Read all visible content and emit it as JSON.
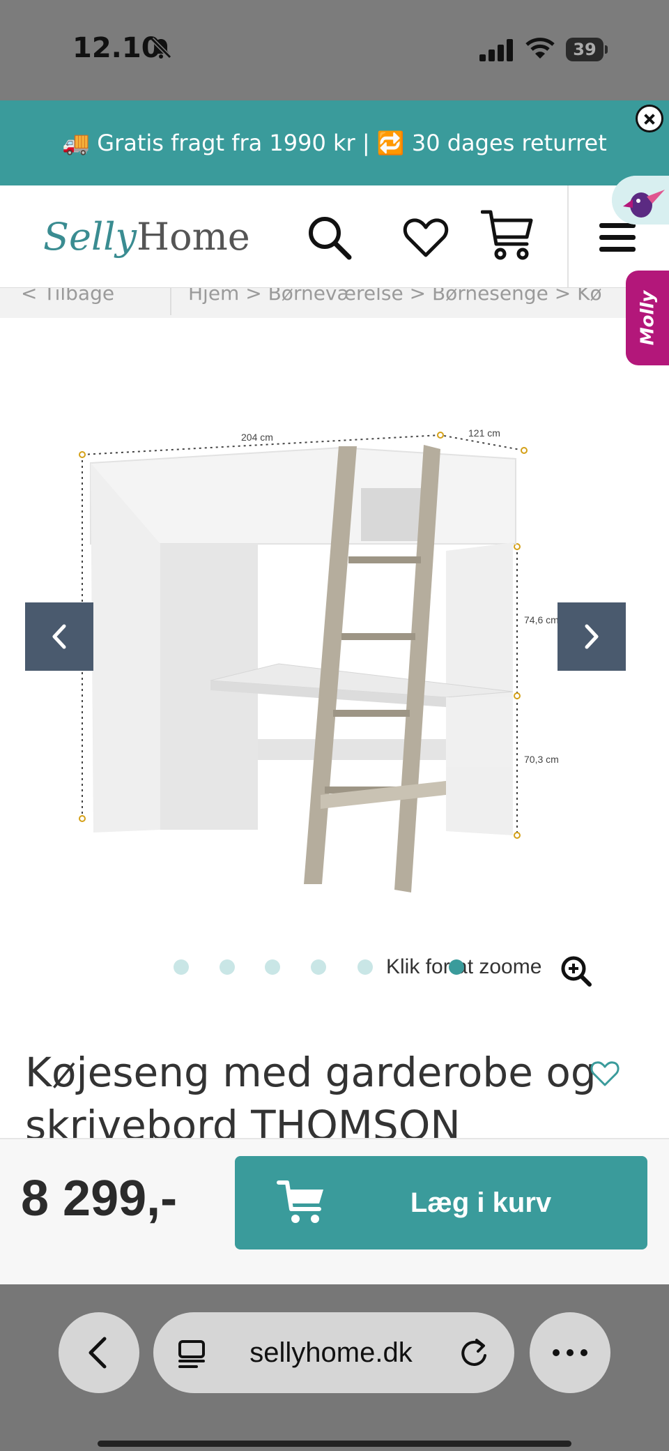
{
  "status_bar": {
    "time": "12.10",
    "battery": "39"
  },
  "promo": {
    "text": "🚚 Gratis fragt fra 1990 kr | 🔁 30 dages returret"
  },
  "header": {
    "logo_script": "Selly",
    "logo_word": "Home"
  },
  "breadcrumb": {
    "back": "< Tilbage",
    "trail": "Hjem > Børneværelse > Børnesenge > Kø"
  },
  "chat": {
    "label": "Molly"
  },
  "product": {
    "image_labels": {
      "width": "204 cm",
      "depth": "121 cm",
      "upper_height": "74,6 cm",
      "desk_height": "70,3 cm"
    },
    "zoom_hint": "Klik for at zoome",
    "title": "Køjeseng med garderobe og skrivebord THOMSON",
    "carousel_dots": 7,
    "active_dot": 6
  },
  "buy_bar": {
    "price": "8 299,-",
    "button_label": "Læg i kurv"
  },
  "browser": {
    "url": "sellyhome.dk"
  },
  "colors": {
    "brand_teal": "#3a9b9b",
    "arrow_slate": "#4a5a6e",
    "chat_magenta": "#b3177a"
  }
}
